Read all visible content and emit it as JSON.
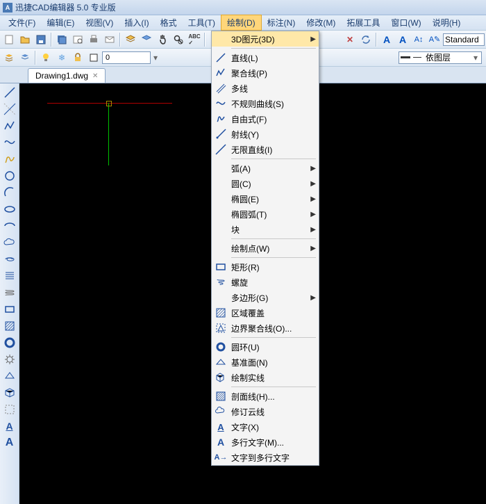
{
  "title": "迅捷CAD编辑器 5.0 专业版",
  "menubar": [
    "文件(F)",
    "编辑(E)",
    "视图(V)",
    "插入(I)",
    "格式",
    "工具(T)",
    "绘制(D)",
    "标注(N)",
    "修改(M)",
    "拓展工具",
    "窗口(W)",
    "说明(H)"
  ],
  "active_menu_index": 6,
  "toolbar2_input": "0",
  "style_combo": "Standard",
  "layer_combo": "依图层",
  "tab": {
    "label": "Drawing1.dwg"
  },
  "dropdown": [
    {
      "type": "item",
      "label": "3D图元(3D)",
      "submenu": true,
      "icon": "",
      "hl": true
    },
    {
      "type": "sep"
    },
    {
      "type": "item",
      "label": "直线(L)",
      "icon": "line"
    },
    {
      "type": "item",
      "label": "聚合线(P)",
      "icon": "polyline"
    },
    {
      "type": "item",
      "label": "多线",
      "icon": "mline"
    },
    {
      "type": "item",
      "label": "不规则曲线(S)",
      "icon": "spline"
    },
    {
      "type": "item",
      "label": "自由式(F)",
      "icon": "freehand"
    },
    {
      "type": "item",
      "label": "射线(Y)",
      "icon": "ray"
    },
    {
      "type": "item",
      "label": "无限直线(I)",
      "icon": "xline"
    },
    {
      "type": "sep"
    },
    {
      "type": "item",
      "label": "弧(A)",
      "submenu": true
    },
    {
      "type": "item",
      "label": "圆(C)",
      "submenu": true
    },
    {
      "type": "item",
      "label": "椭圆(E)",
      "submenu": true
    },
    {
      "type": "item",
      "label": "椭圆弧(T)",
      "submenu": true
    },
    {
      "type": "item",
      "label": "块",
      "submenu": true
    },
    {
      "type": "sep"
    },
    {
      "type": "item",
      "label": "绘制点(W)",
      "submenu": true
    },
    {
      "type": "sep"
    },
    {
      "type": "item",
      "label": "矩形(R)",
      "icon": "rect"
    },
    {
      "type": "item",
      "label": "螺旋",
      "icon": "helix"
    },
    {
      "type": "item",
      "label": "多边形(G)",
      "submenu": true
    },
    {
      "type": "item",
      "label": "区域覆盖",
      "icon": "region"
    },
    {
      "type": "item",
      "label": "边界聚合线(O)...",
      "icon": "boundary"
    },
    {
      "type": "sep"
    },
    {
      "type": "item",
      "label": "圆环(U)",
      "icon": "donut"
    },
    {
      "type": "item",
      "label": "基准面(N)",
      "icon": "plane"
    },
    {
      "type": "item",
      "label": "绘制实线",
      "icon": "solidline"
    },
    {
      "type": "sep"
    },
    {
      "type": "item",
      "label": "剖面线(H)...",
      "icon": "hatch"
    },
    {
      "type": "item",
      "label": "修订云线",
      "icon": "cloud"
    },
    {
      "type": "item",
      "label": "文字(X)",
      "icon": "text"
    },
    {
      "type": "item",
      "label": "多行文字(M)...",
      "icon": "mtext"
    },
    {
      "type": "item",
      "label": "文字到多行文字",
      "icon": "txt2m"
    }
  ]
}
